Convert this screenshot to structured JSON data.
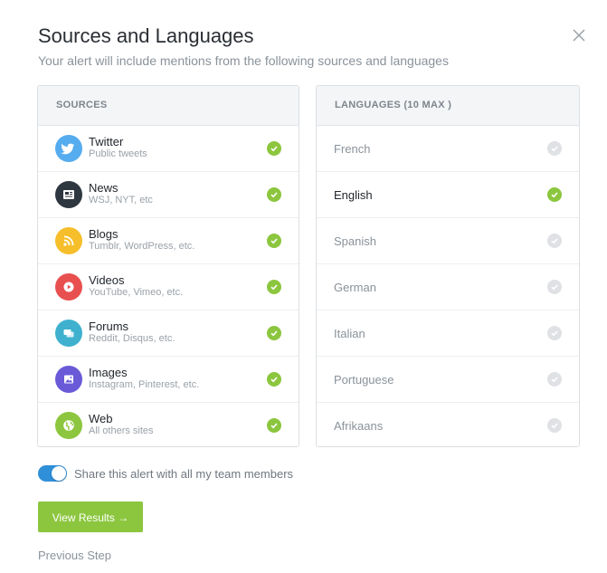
{
  "dialog": {
    "title": "Sources and Languages",
    "subtitle": "Your alert will include mentions from the following sources and languages"
  },
  "sources": {
    "header": "SOURCES",
    "items": [
      {
        "name": "Twitter",
        "desc": "Public tweets",
        "icon": "twitter-icon",
        "color": "#55acee",
        "checked": true
      },
      {
        "name": "News",
        "desc": "WSJ, NYT, etc",
        "icon": "newspaper-icon",
        "color": "#2e3640",
        "checked": true
      },
      {
        "name": "Blogs",
        "desc": "Tumblr, WordPress, etc.",
        "icon": "rss-icon",
        "color": "#f6be2a",
        "checked": true
      },
      {
        "name": "Videos",
        "desc": "YouTube, Vimeo, etc.",
        "icon": "play-icon",
        "color": "#e8504f",
        "checked": true
      },
      {
        "name": "Forums",
        "desc": "Reddit, Disqus, etc.",
        "icon": "chat-icon",
        "color": "#3fb1cf",
        "checked": true
      },
      {
        "name": "Images",
        "desc": "Instagram, Pinterest, etc.",
        "icon": "image-icon",
        "color": "#6a5ad8",
        "checked": true
      },
      {
        "name": "Web",
        "desc": "All others sites",
        "icon": "globe-icon",
        "color": "#8cc63f",
        "checked": true
      }
    ]
  },
  "languages": {
    "header": "LANGUAGES (10 MAX )",
    "items": [
      {
        "name": "French",
        "checked": false
      },
      {
        "name": "English",
        "checked": true
      },
      {
        "name": "Spanish",
        "checked": false
      },
      {
        "name": "German",
        "checked": false
      },
      {
        "name": "Italian",
        "checked": false
      },
      {
        "name": "Portuguese",
        "checked": false
      },
      {
        "name": "Afrikaans",
        "checked": false
      }
    ]
  },
  "share": {
    "label": "Share this alert with all my team members",
    "enabled": true
  },
  "actions": {
    "view_results": "View Results →",
    "previous": "Previous Step"
  },
  "colors": {
    "accent_green": "#8cc63f",
    "toggle_blue": "#2f8fd8"
  }
}
